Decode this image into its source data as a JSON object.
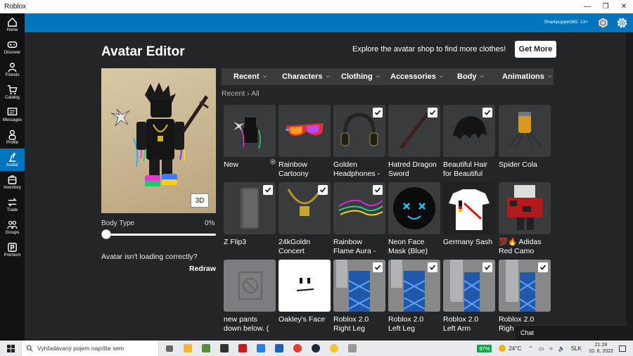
{
  "window": {
    "title": "Roblox"
  },
  "nav": [
    {
      "label": "Home",
      "icon": "home-icon"
    },
    {
      "label": "Discover",
      "icon": "gamepad-icon"
    },
    {
      "label": "Friends",
      "icon": "friends-icon"
    },
    {
      "label": "Catalog",
      "icon": "cart-icon"
    },
    {
      "label": "Messages",
      "icon": "message-icon"
    },
    {
      "label": "Profile",
      "icon": "profile-icon"
    },
    {
      "label": "Avatar",
      "icon": "avatar-icon",
      "active": true
    },
    {
      "label": "Inventory",
      "icon": "inventory-icon"
    },
    {
      "label": "Trade",
      "icon": "trade-icon"
    },
    {
      "label": "Groups",
      "icon": "groups-icon"
    },
    {
      "label": "Premium",
      "icon": "premium-icon"
    }
  ],
  "header": {
    "username": "Sharkpuppet365: 13+"
  },
  "editor": {
    "title": "Avatar Editor",
    "promo": "Explore the avatar shop to find more clothes!",
    "get_more": "Get More",
    "view_3d": "3D",
    "body_type_label": "Body Type",
    "body_type_value": "0%",
    "body_type_level": 0,
    "not_loading": "Avatar isn't loading correctly?",
    "redraw": "Redraw",
    "tabs": [
      "Recent",
      "Characters",
      "Clothing",
      "Accessories",
      "Body",
      "Animations"
    ],
    "breadcrumb": "Recent › All"
  },
  "items": [
    {
      "label": "New",
      "checked": false,
      "icon": "character-thumb"
    },
    {
      "label": "Rainbow\nCartoony",
      "checked": false,
      "icon": "sunglasses-thumb"
    },
    {
      "label": "Golden\nHeadphones -",
      "checked": true,
      "icon": "headphones-thumb"
    },
    {
      "label": "Hatred Dragon\nSword",
      "checked": true,
      "icon": "sword-thumb"
    },
    {
      "label": "Beautiful Hair\nfor Beautiful",
      "checked": true,
      "icon": "hair-thumb"
    },
    {
      "label": "Spider Cola",
      "checked": false,
      "icon": "spider-thumb"
    },
    {
      "label": "Z Flip3",
      "checked": true,
      "icon": "phone-thumb"
    },
    {
      "label": "24kGoldn\nConcert",
      "checked": true,
      "icon": "chain-thumb"
    },
    {
      "label": "Rainbow\nFlame Aura -",
      "checked": true,
      "icon": "aura-thumb"
    },
    {
      "label": "Neon Face\nMask (Blue)",
      "checked": false,
      "icon": "mask-thumb"
    },
    {
      "label": "Germany Sash",
      "checked": false,
      "icon": "shirt-thumb"
    },
    {
      "label": "💯🔥 Adidas\nRed Camo",
      "checked": false,
      "icon": "camo-thumb"
    },
    {
      "label": "new pants\ndown below. (",
      "checked": false,
      "icon": "pants-thumb"
    },
    {
      "label": "Oakley's Face",
      "checked": false,
      "icon": "face-thumb"
    },
    {
      "label": "Roblox 2.0\nRight Leg",
      "checked": true,
      "icon": "leg-thumb"
    },
    {
      "label": "Roblox 2.0\nLeft Leg",
      "checked": true,
      "icon": "leg-thumb"
    },
    {
      "label": "Roblox 2.0\nLeft Arm",
      "checked": true,
      "icon": "arm-thumb"
    },
    {
      "label": "Roblox 2.0\nRigh",
      "checked": true,
      "icon": "arm-thumb"
    }
  ],
  "chat": {
    "label": "Chat"
  },
  "taskbar": {
    "search_placeholder": "Vyhľadávaný pojem napíšte sem",
    "battery": "97%",
    "weather": "24°C",
    "language": "SLK",
    "time": "21:28",
    "date": "10. 6. 2022"
  },
  "colors": {
    "accent": "#0074bd",
    "background": "#232527",
    "tile": "#393b3d"
  }
}
